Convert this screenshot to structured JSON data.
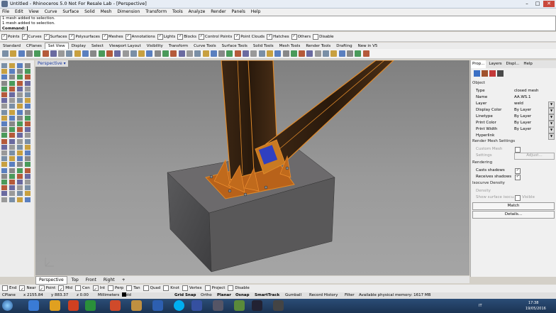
{
  "window": {
    "title": "Untitled - Rhinoceros 5.0 Not For Resale Lab - [Perspective]",
    "minimize": "–",
    "maximize": "□",
    "close": "✕"
  },
  "menu": [
    "File",
    "Edit",
    "View",
    "Curve",
    "Surface",
    "Solid",
    "Mesh",
    "Dimension",
    "Transform",
    "Tools",
    "Analyze",
    "Render",
    "Panels",
    "Help"
  ],
  "command_history": [
    "1 mesh added to selection.",
    "1 mesh added to selection."
  ],
  "command_label": "Command:",
  "selection_filters": [
    {
      "label": "Points",
      "checked": true
    },
    {
      "label": "Curves",
      "checked": true
    },
    {
      "label": "Surfaces",
      "checked": true
    },
    {
      "label": "Polysurfaces",
      "checked": true
    },
    {
      "label": "Meshes",
      "checked": true
    },
    {
      "label": "Annotations",
      "checked": true
    },
    {
      "label": "Lights",
      "checked": true
    },
    {
      "label": "Blocks",
      "checked": true
    },
    {
      "label": "Control Points",
      "checked": true
    },
    {
      "label": "Point Clouds",
      "checked": true
    },
    {
      "label": "Hatches",
      "checked": true
    },
    {
      "label": "Others",
      "checked": true
    },
    {
      "label": "Disable",
      "checked": false
    }
  ],
  "toolbar_tabs": [
    "Standard",
    "CPlanes",
    "Set View",
    "Display",
    "Select",
    "Viewport Layout",
    "Visibility",
    "Transform",
    "Curve Tools",
    "Surface Tools",
    "Solid Tools",
    "Mesh Tools",
    "Render Tools",
    "Drafting",
    "New in V5"
  ],
  "active_toolbar_tab": "Set View",
  "viewport": {
    "label": "Perspective",
    "menu_arrow": "▾"
  },
  "viewport_tabs": [
    "Perspective",
    "Top",
    "Front",
    "Right"
  ],
  "viewport_tab_add": "+",
  "right_panel": {
    "tabs": [
      "Prop...",
      "Layers",
      "Displ...",
      "Help"
    ],
    "object_section": "Object",
    "rows": [
      {
        "key": "Type",
        "value": "closed mesh"
      },
      {
        "key": "Name",
        "value": "AA.WS.1"
      },
      {
        "key": "Layer",
        "value": "weld"
      },
      {
        "key": "Display Color",
        "value": "By Layer"
      },
      {
        "key": "Linetype",
        "value": "By Layer"
      },
      {
        "key": "Print Color",
        "value": "By Layer"
      },
      {
        "key": "Print Width",
        "value": "By Layer"
      },
      {
        "key": "Hyperlink",
        "value": ""
      }
    ],
    "render_mesh_section": "Render Mesh Settings",
    "custom_mesh": "Custom Mesh",
    "settings": "Settings",
    "adjust_button": "Adjust...",
    "rendering_section": "Rendering",
    "casts_shadows": "Casts shadows",
    "receives_shadows": "Receives shadows",
    "isocurve_section": "Isocurve Density",
    "density": "Density",
    "show_surface": "Show surface isocu...",
    "visible": "Visible",
    "match_button": "Match",
    "details_button": "Details..."
  },
  "osnaps": [
    {
      "label": "End",
      "checked": false
    },
    {
      "label": "Near",
      "checked": true
    },
    {
      "label": "Point",
      "checked": true
    },
    {
      "label": "Mid",
      "checked": true
    },
    {
      "label": "Cen",
      "checked": false
    },
    {
      "label": "Int",
      "checked": true
    },
    {
      "label": "Perp",
      "checked": false
    },
    {
      "label": "Tan",
      "checked": false
    },
    {
      "label": "Quad",
      "checked": false
    },
    {
      "label": "Knot",
      "checked": false
    },
    {
      "label": "Vertex",
      "checked": false
    },
    {
      "label": "Project",
      "checked": false
    },
    {
      "label": "Disable",
      "checked": false
    }
  ],
  "status_bar": {
    "cplane": "CPlane",
    "x": "x 2155.84",
    "y": "y 883.37",
    "z": "z 0.00",
    "units": "Millimeters",
    "layer": "weld",
    "grid_snap": "Grid Snap",
    "ortho": "Ortho",
    "planar": "Planar",
    "osnap": "Osnap",
    "smarttrack": "SmartTrack",
    "gumball": "Gumball",
    "record_history": "Record History",
    "filter": "Filter",
    "memory": "Available physical memory: 1617 MB"
  },
  "taskbar": {
    "language": "IT",
    "time": "17:38",
    "date": "19/05/2016"
  },
  "colors": {
    "steel_orange": "#d87a1e",
    "viewport_bg": "#8e8e8e",
    "taskbar": "#1f3b5e"
  }
}
